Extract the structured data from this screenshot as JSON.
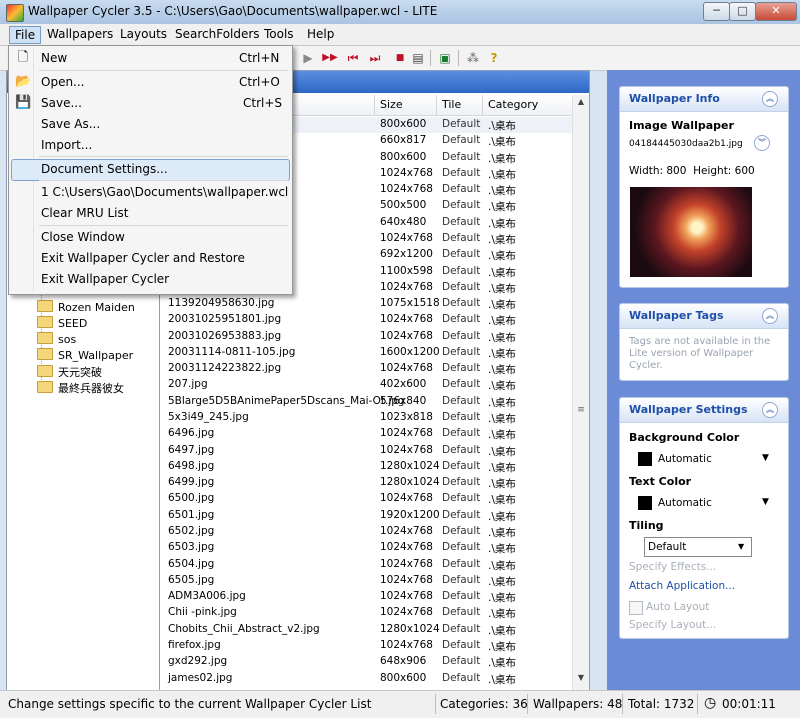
{
  "window": {
    "title": "Wallpaper Cycler 3.5 - C:\\Users\\Gao\\Documents\\wallpaper.wcl - LITE",
    "min_glyph": "─",
    "max_glyph": "□",
    "close_glyph": "✕"
  },
  "menubar": [
    "File",
    "Wallpapers",
    "Layouts",
    "SearchFolders",
    "Tools",
    "Help"
  ],
  "file_menu": {
    "items": [
      {
        "label": "New",
        "shortcut": "Ctrl+N",
        "icon": "new-document-icon"
      },
      {
        "label": "Open...",
        "shortcut": "Ctrl+O",
        "icon": "open-folder-icon"
      },
      {
        "label": "Save...",
        "shortcut": "Ctrl+S",
        "icon": "save-disk-icon"
      },
      {
        "label": "Save As...",
        "shortcut": ""
      },
      {
        "label": "Import...",
        "shortcut": ""
      },
      {
        "label": "Document Settings...",
        "shortcut": "",
        "selected": true
      },
      {
        "label": "1 C:\\Users\\Gao\\Documents\\wallpaper.wcl",
        "shortcut": ""
      },
      {
        "label": "Clear MRU List",
        "shortcut": ""
      },
      {
        "label": "Close Window",
        "shortcut": ""
      },
      {
        "label": "Exit Wallpaper Cycler and Restore",
        "shortcut": ""
      },
      {
        "label": "Exit Wallpaper Cycler",
        "shortcut": ""
      }
    ]
  },
  "tree": {
    "partial_item": "...",
    "items": [
      "Rozen Maiden",
      "SEED",
      "sos",
      "SR_Wallpaper",
      "天元突破",
      "最終兵器彼女"
    ]
  },
  "list": {
    "columns": [
      "Size",
      "Tile",
      "Category"
    ],
    "rows": [
      {
        "name": "",
        "size": "800x600",
        "tile": "Default",
        "cat": ".\\桌布"
      },
      {
        "name": "",
        "size": "660x817",
        "tile": "Default",
        "cat": ".\\桌布"
      },
      {
        "name": "",
        "size": "800x600",
        "tile": "Default",
        "cat": ".\\桌布"
      },
      {
        "name": "",
        "size": "1024x768",
        "tile": "Default",
        "cat": ".\\桌布"
      },
      {
        "name": "",
        "size": "1024x768",
        "tile": "Default",
        "cat": ".\\桌布"
      },
      {
        "name": "",
        "size": "500x500",
        "tile": "Default",
        "cat": ".\\桌布"
      },
      {
        "name": "",
        "size": "640x480",
        "tile": "Default",
        "cat": ".\\桌布"
      },
      {
        "name": "",
        "size": "1024x768",
        "tile": "Default",
        "cat": ".\\桌布"
      },
      {
        "name": "",
        "size": "692x1200",
        "tile": "Default",
        "cat": ".\\桌布"
      },
      {
        "name": "",
        "size": "1100x598",
        "tile": "Default",
        "cat": ".\\桌布"
      },
      {
        "name": "",
        "size": "1024x768",
        "tile": "Default",
        "cat": ".\\桌布"
      },
      {
        "name": "1139204958630.jpg",
        "size": "1075x1518",
        "tile": "Default",
        "cat": ".\\桌布"
      },
      {
        "name": "20031025951801.jpg",
        "size": "1024x768",
        "tile": "Default",
        "cat": ".\\桌布"
      },
      {
        "name": "20031026953883.jpg",
        "size": "1024x768",
        "tile": "Default",
        "cat": ".\\桌布"
      },
      {
        "name": "20031114-0811-105.jpg",
        "size": "1600x1200",
        "tile": "Default",
        "cat": ".\\桌布"
      },
      {
        "name": "20031124223822.jpg",
        "size": "1024x768",
        "tile": "Default",
        "cat": ".\\桌布"
      },
      {
        "name": "207.jpg",
        "size": "402x600",
        "tile": "Default",
        "cat": ".\\桌布"
      },
      {
        "name": "5Blarge5D5BAnimePaper5Dscans_Mai-Ot.jpg",
        "size": "576x840",
        "tile": "Default",
        "cat": ".\\桌布"
      },
      {
        "name": "5x3i49_245.jpg",
        "size": "1023x818",
        "tile": "Default",
        "cat": ".\\桌布"
      },
      {
        "name": "6496.jpg",
        "size": "1024x768",
        "tile": "Default",
        "cat": ".\\桌布"
      },
      {
        "name": "6497.jpg",
        "size": "1024x768",
        "tile": "Default",
        "cat": ".\\桌布"
      },
      {
        "name": "6498.jpg",
        "size": "1280x1024",
        "tile": "Default",
        "cat": ".\\桌布"
      },
      {
        "name": "6499.jpg",
        "size": "1280x1024",
        "tile": "Default",
        "cat": ".\\桌布"
      },
      {
        "name": "6500.jpg",
        "size": "1024x768",
        "tile": "Default",
        "cat": ".\\桌布"
      },
      {
        "name": "6501.jpg",
        "size": "1920x1200",
        "tile": "Default",
        "cat": ".\\桌布"
      },
      {
        "name": "6502.jpg",
        "size": "1024x768",
        "tile": "Default",
        "cat": ".\\桌布"
      },
      {
        "name": "6503.jpg",
        "size": "1024x768",
        "tile": "Default",
        "cat": ".\\桌布"
      },
      {
        "name": "6504.jpg",
        "size": "1024x768",
        "tile": "Default",
        "cat": ".\\桌布"
      },
      {
        "name": "6505.jpg",
        "size": "1024x768",
        "tile": "Default",
        "cat": ".\\桌布"
      },
      {
        "name": "ADM3A006.jpg",
        "size": "1024x768",
        "tile": "Default",
        "cat": ".\\桌布"
      },
      {
        "name": "Chii -pink.jpg",
        "size": "1024x768",
        "tile": "Default",
        "cat": ".\\桌布"
      },
      {
        "name": "Chobits_Chii_Abstract_v2.jpg",
        "size": "1280x1024",
        "tile": "Default",
        "cat": ".\\桌布"
      },
      {
        "name": "firefox.jpg",
        "size": "1024x768",
        "tile": "Default",
        "cat": ".\\桌布"
      },
      {
        "name": "gxd292.jpg",
        "size": "648x906",
        "tile": "Default",
        "cat": ".\\桌布"
      },
      {
        "name": "james02.jpg",
        "size": "800x600",
        "tile": "Default",
        "cat": ".\\桌布"
      }
    ]
  },
  "info_panel": {
    "title": "Wallpaper Info",
    "image_label": "Image Wallpaper",
    "filename": "04184445030daa2b1.jpg",
    "dimensions": "Width: 800  Height: 600"
  },
  "tags_panel": {
    "title": "Wallpaper Tags",
    "note": "Tags are not available in the Lite version of Wallpaper Cycler."
  },
  "settings_panel": {
    "title": "Wallpaper Settings",
    "bg_label": "Background Color",
    "bg_value": "Automatic",
    "text_label": "Text Color",
    "text_value": "Automatic",
    "tiling_label": "Tiling",
    "tiling_value": "Default",
    "specify_effects": "Specify Effects...",
    "attach_app": "Attach Application...",
    "auto_layout": "Auto Layout",
    "specify_layout": "Specify Layout..."
  },
  "status": {
    "message": "Change settings specific to the current Wallpaper Cycler List",
    "categories": "Categories: 36",
    "wallpapers": "Wallpapers: 48",
    "total": "Total: 1732",
    "timer": "00:01:11"
  },
  "colors": {
    "accent": "#2d68c6",
    "panel_bg": "#6b8bd6",
    "link": "#1f4fa6"
  }
}
